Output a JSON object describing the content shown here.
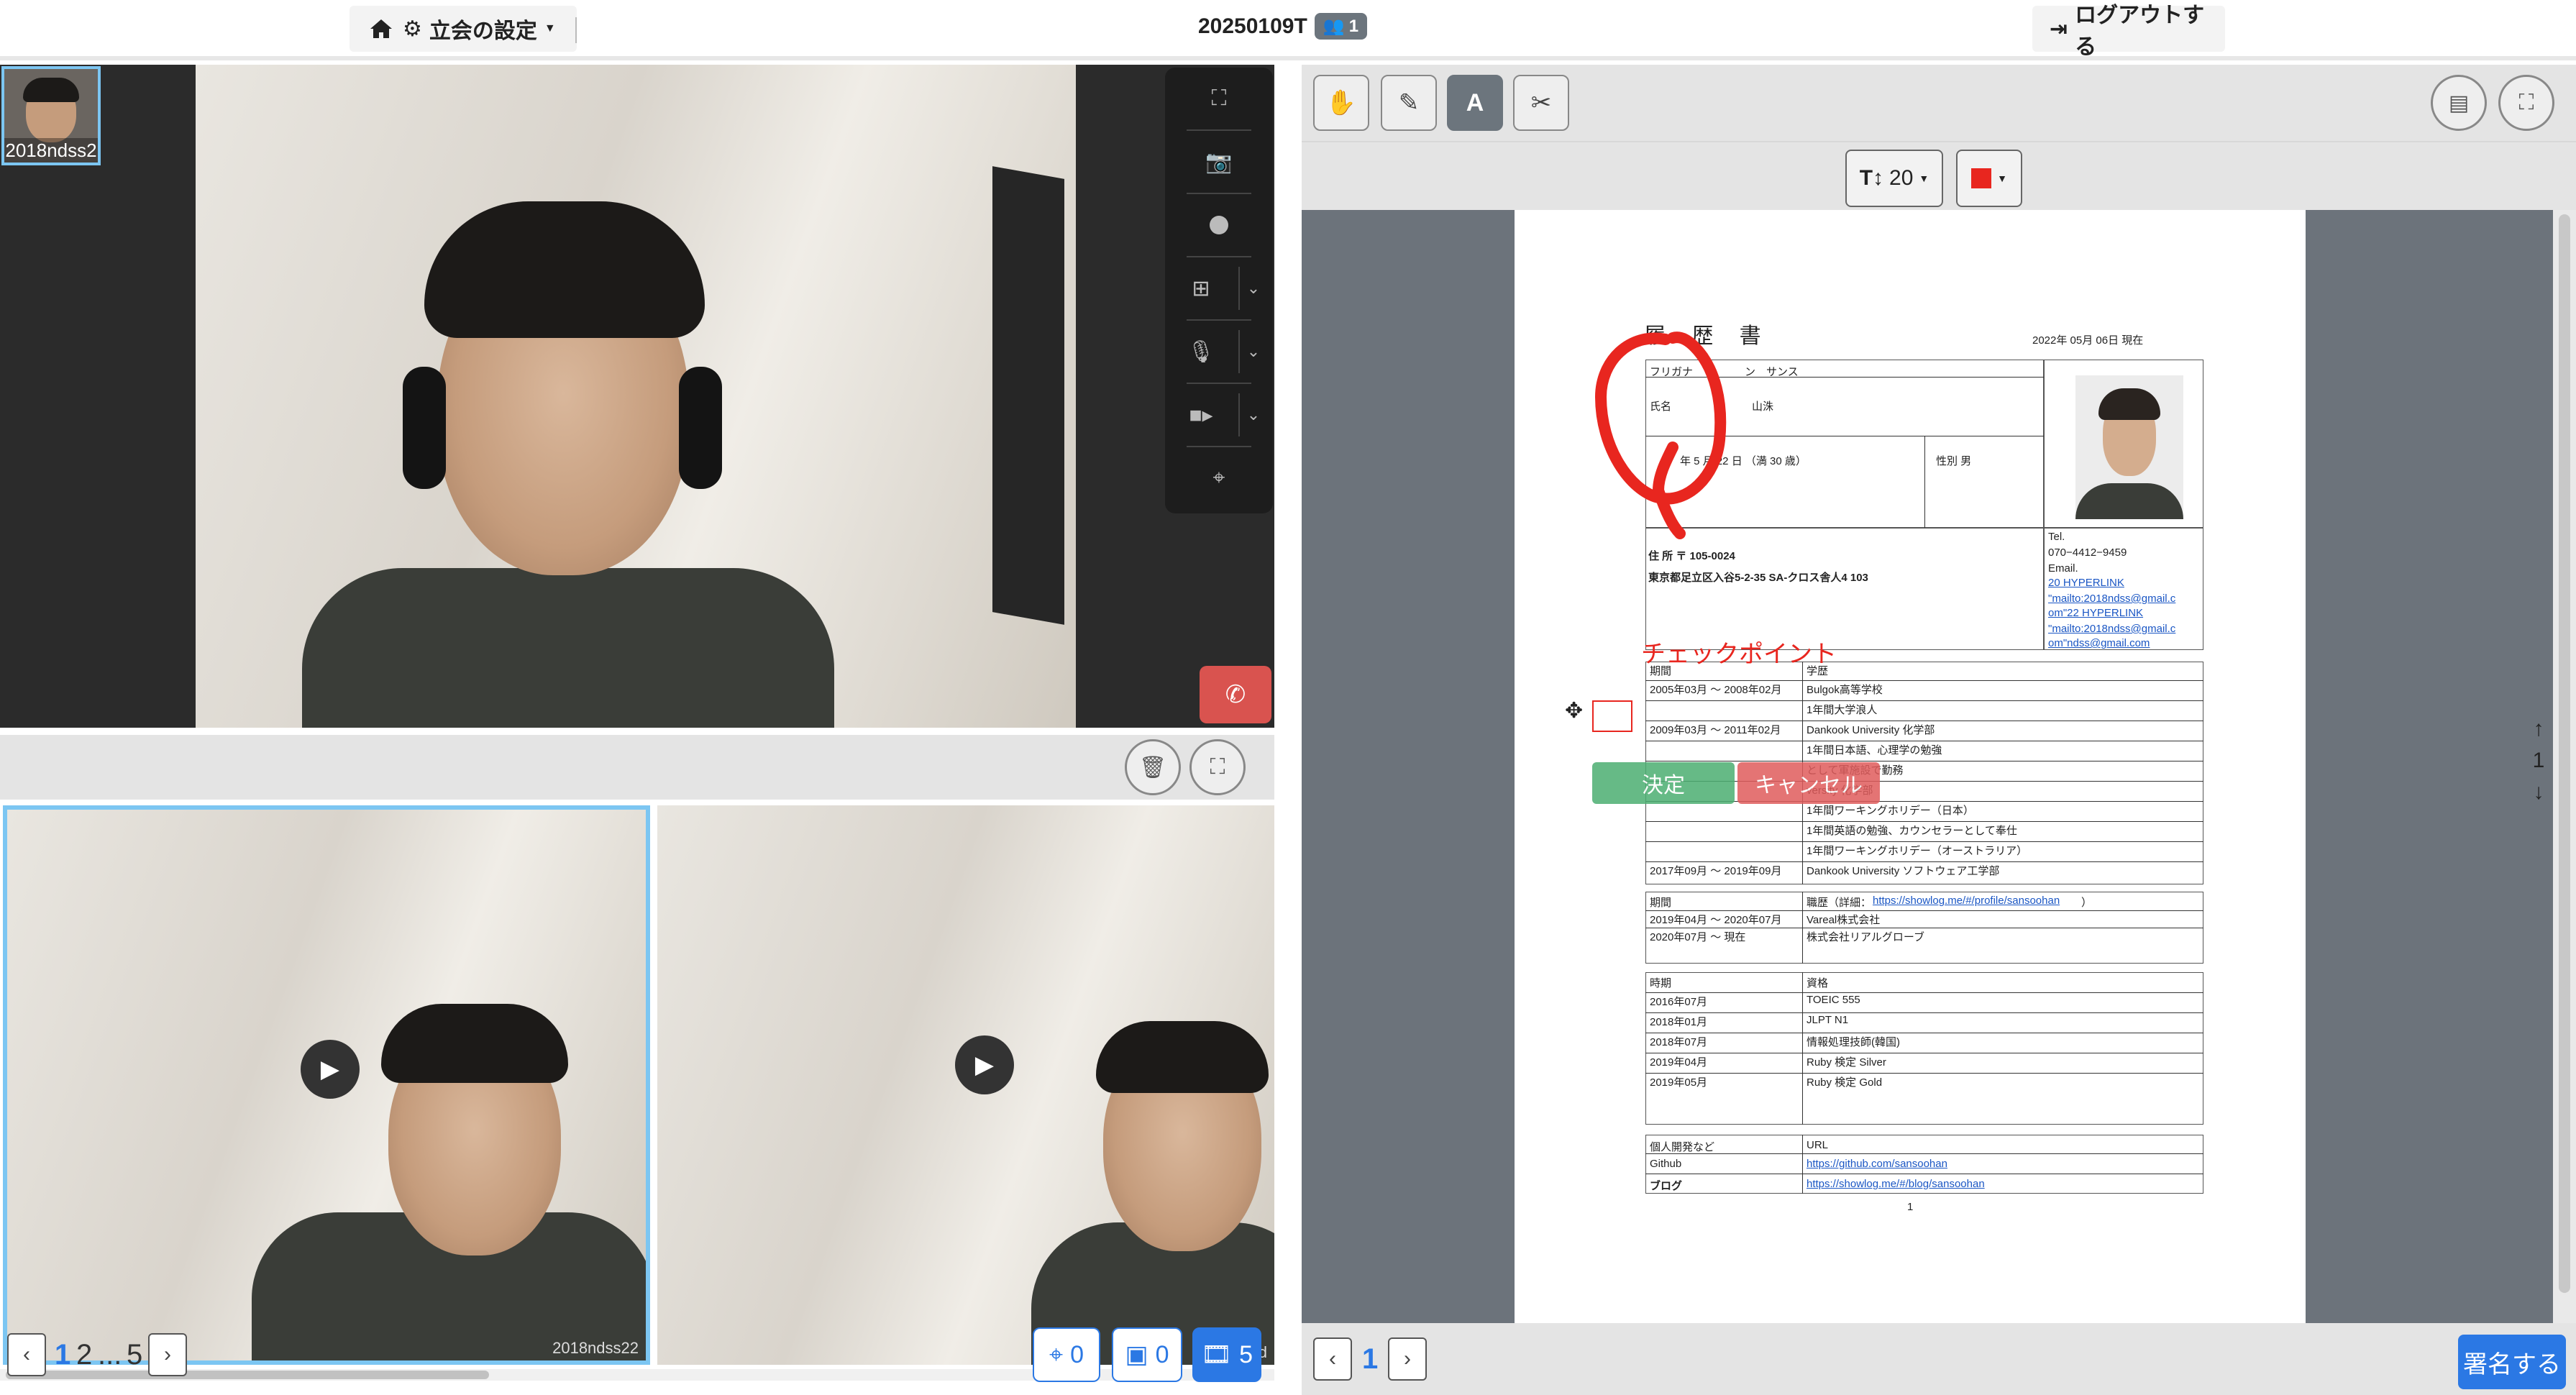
{
  "topbar": {
    "settings_label": "立会の設定",
    "session_id": "20250109T",
    "participant_count": "1",
    "logout_label": "ログアウトする"
  },
  "video": {
    "thumbnail_name": "2018ndss2",
    "recordings": [
      {
        "label": "2018ndss22"
      },
      {
        "label": "2018nd"
      }
    ]
  },
  "recordings_pager": {
    "current_page": "1",
    "page2": "2",
    "ellipsis": "...",
    "last_page": "5"
  },
  "counters": {
    "drone": "0",
    "images": "0",
    "videos": "5"
  },
  "pdf": {
    "font_size": "20",
    "color": "#e8261f",
    "current_page": "1",
    "bottom_page": "1",
    "annotation_text": "チェックポイント",
    "confirm_label": "決定",
    "cancel_label": "キャンセル",
    "sign_label": "署名する"
  },
  "resume": {
    "title": "履 歴 書",
    "date": "2022年 05月 06日 現在",
    "furigana_label": "フリガナ",
    "furigana_value": "ン　サンス",
    "name_label": "氏名",
    "name_value": "山洙",
    "birth": "年 5 月 22 日 （満 30 歳）",
    "gender": "性別 男",
    "address_label": "住 所 〒 105-0024",
    "address_value": "東京都足立区入谷5-2-35 SA-クロス舎人4 103",
    "tel_label": "Tel.",
    "tel_value": "070−4412−9459",
    "email_label": "Email.",
    "email_lines": [
      "20 HYPERLINK",
      "\"mailto:2018ndss@gmail.c",
      "om\"22 HYPERLINK",
      "\"mailto:2018ndss@gmail.c",
      "om\"ndss@gmail.com"
    ],
    "period_header": "期間",
    "history_header": "学歴",
    "education": [
      {
        "period": "2005年03月 〜 2008年02月",
        "item": "Bulgok高等学校"
      },
      {
        "period": "",
        "item": "1年間大学浪人"
      },
      {
        "period": "2009年03月 〜 2011年02月",
        "item": "Dankook University 化学部"
      },
      {
        "period": "",
        "item": "1年間日本語、心理学の勉強"
      },
      {
        "period": "",
        "item": "として軍施設で勤務"
      },
      {
        "period": "",
        "item": "versity 化学部"
      },
      {
        "period": "",
        "item": "1年間ワーキングホリデー（日本）"
      },
      {
        "period": "",
        "item": "1年間英語の勉強、カウンセラーとして奉仕"
      },
      {
        "period": "",
        "item": "1年間ワーキングホリデー（オーストラリア）"
      },
      {
        "period": "2017年09月 〜 2019年09月",
        "item": "Dankook University ソフトウェア工学部"
      }
    ],
    "work_header": "職歴（詳細：",
    "work_link": "https://showlog.me/#/profile/sansoohan",
    "work_header_end": "）",
    "work": [
      {
        "period": "2019年04月 〜 2020年07月",
        "item": "Vareal株式会社"
      },
      {
        "period": "2020年07月 〜 現在",
        "item": "株式会社リアルグローブ"
      }
    ],
    "cert_period_header": "時期",
    "cert_header": "資格",
    "certs": [
      {
        "period": "2016年07月",
        "item": "TOEIC 555"
      },
      {
        "period": "2018年01月",
        "item": "JLPT N1"
      },
      {
        "period": "2018年07月",
        "item": "情報処理技師(韓国)"
      },
      {
        "period": "2019年04月",
        "item": "Ruby 検定 Silver"
      },
      {
        "period": "2019年05月",
        "item": "Ruby 検定 Gold"
      }
    ],
    "dev_header": "個人開発など",
    "url_header": "URL",
    "github_label": "Github",
    "github_link": "https://github.com/sansoohan",
    "blog_label": "ブログ",
    "blog_link": "https://showlog.me/#/blog/sansoohan",
    "page_number": "1"
  }
}
